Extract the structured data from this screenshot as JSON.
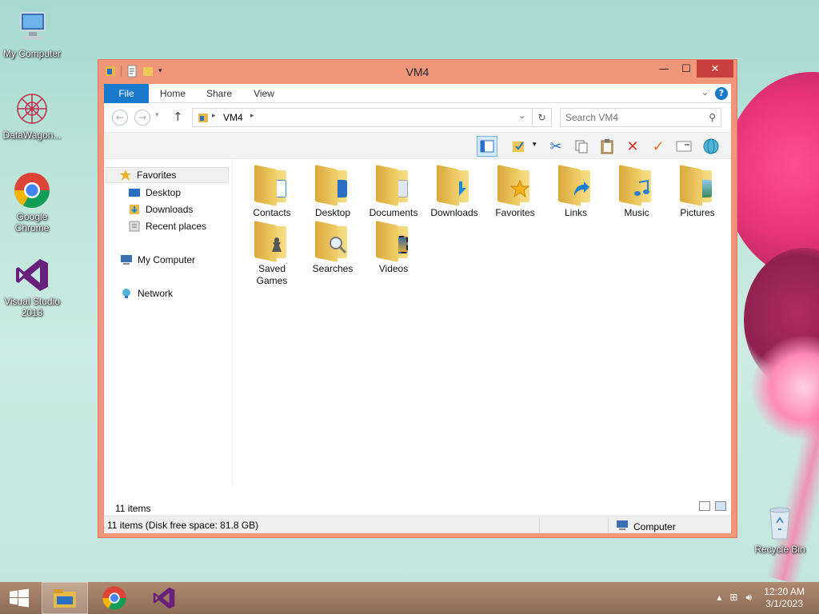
{
  "desktop": {
    "icons": [
      {
        "label": "My Computer",
        "icon": "computer-icon"
      },
      {
        "label": "DataWagon...",
        "icon": "datawagon-icon"
      },
      {
        "label": "Google Chrome",
        "icon": "chrome-icon"
      },
      {
        "label": "Visual Studio 2013",
        "icon": "visual-studio-icon"
      },
      {
        "label": "Recycle Bin",
        "icon": "recycle-bin-icon"
      }
    ]
  },
  "window": {
    "title": "VM4",
    "controls": {
      "minimize": "—",
      "maximize": "☐",
      "close": "✕"
    }
  },
  "ribbon": {
    "tabs": [
      "File",
      "Home",
      "Share",
      "View"
    ],
    "help": "?"
  },
  "navigation": {
    "back": "←",
    "forward": "→",
    "up": "↑",
    "address_path": "VM4",
    "search_placeholder": "Search VM4"
  },
  "nav_pane": {
    "favorites": "Favorites",
    "favorites_items": [
      "Desktop",
      "Downloads",
      "Recent places"
    ],
    "my_computer": "My Computer",
    "network": "Network"
  },
  "folders": [
    {
      "label": "Contacts",
      "icon": "contacts-folder-icon",
      "color": "#3b8ad6"
    },
    {
      "label": "Desktop",
      "icon": "desktop-folder-icon",
      "color": "#2a6fc2"
    },
    {
      "label": "Documents",
      "icon": "documents-folder-icon",
      "color": "#dfe7f3"
    },
    {
      "label": "Downloads",
      "icon": "downloads-folder-icon",
      "color": "#1e88d6"
    },
    {
      "label": "Favorites",
      "icon": "favorites-folder-icon",
      "color": "#f2b01e"
    },
    {
      "label": "Links",
      "icon": "links-folder-icon",
      "color": "#1a7fd0"
    },
    {
      "label": "Music",
      "icon": "music-folder-icon",
      "color": "#2a7fd3"
    },
    {
      "label": "Pictures",
      "icon": "pictures-folder-icon",
      "color": "#5fa6d8"
    },
    {
      "label": "Saved Games",
      "icon": "saved-games-folder-icon",
      "color": "#777777"
    },
    {
      "label": "Searches",
      "icon": "searches-folder-icon",
      "color": "#c9d6e3"
    },
    {
      "label": "Videos",
      "icon": "videos-folder-icon",
      "color": "#3a6aa0"
    }
  ],
  "status": {
    "item_count": "11 items",
    "statusbar_left": "11 items (Disk free space: 81.8 GB)",
    "statusbar_right": "Computer"
  },
  "taskbar": {
    "apps": [
      {
        "name": "file-explorer-icon",
        "active": true
      },
      {
        "name": "chrome-icon",
        "active": false
      },
      {
        "name": "visual-studio-icon",
        "active": false
      }
    ],
    "time": "12:20 AM",
    "date": "3/1/2023"
  },
  "colors": {
    "window_frame": "#f0967a",
    "file_tab": "#1979ca",
    "close_button": "#c7403b"
  }
}
